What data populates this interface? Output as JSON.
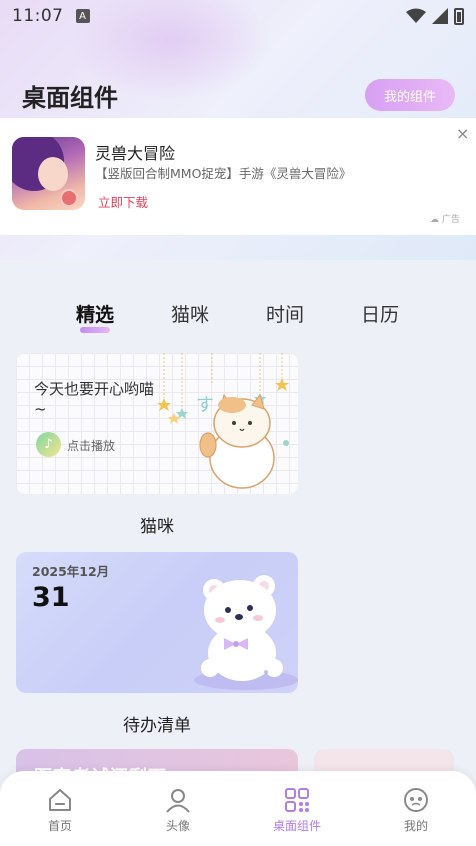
{
  "status_bar": {
    "time": "11:07",
    "notification_icon": "A"
  },
  "header": {
    "title": "桌面组件",
    "my_widgets_label": "我的组件"
  },
  "ad": {
    "title": "灵兽大冒险",
    "description": "【竖版回合制MMO捉宠】手游《灵兽大冒险》",
    "cta": "立即下载",
    "close": "×",
    "label": "广告"
  },
  "tabs": [
    {
      "label": "精选",
      "active": true
    },
    {
      "label": "猫咪",
      "active": false
    },
    {
      "label": "时间",
      "active": false
    },
    {
      "label": "日历",
      "active": false
    }
  ],
  "widgets": {
    "cat": {
      "text": "今天也要开心哟喵~",
      "play_label": "点击播放",
      "label": "猫咪"
    },
    "todo": {
      "date": "2025年12月",
      "day": "31",
      "label": "待办清单"
    },
    "partial": {
      "text": "距离考试还剩下"
    }
  },
  "bottom_nav": [
    {
      "label": "首页",
      "icon": "home-icon",
      "active": false
    },
    {
      "label": "头像",
      "icon": "avatar-icon",
      "active": false
    },
    {
      "label": "桌面组件",
      "icon": "widgets-icon",
      "active": true
    },
    {
      "label": "我的",
      "icon": "profile-icon",
      "active": false
    }
  ],
  "colors": {
    "accent": "#c08cf0",
    "cta_red": "#e0435a",
    "nav_active": "#b07ee8"
  }
}
